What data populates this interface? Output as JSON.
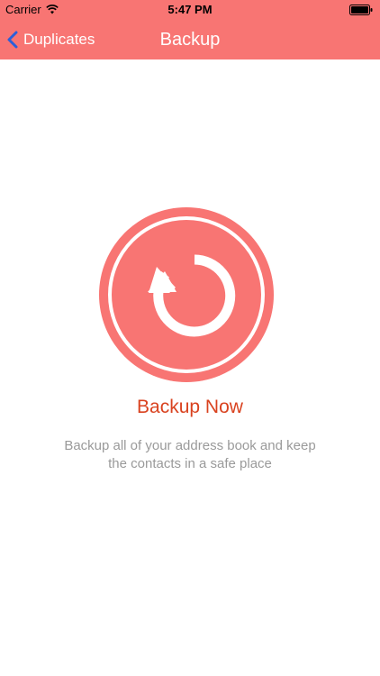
{
  "status_bar": {
    "carrier": "Carrier",
    "time": "5:47 PM",
    "wifi_icon": "wifi-icon",
    "battery_icon": "battery-icon"
  },
  "nav": {
    "back_label": "Duplicates",
    "back_icon": "chevron-left-icon",
    "title": "Backup"
  },
  "main": {
    "backup_icon": "circular-arrow-icon",
    "action_label": "Backup Now",
    "description": "Backup all of your address book and keep the contacts in a safe place"
  },
  "colors": {
    "accent": "#F87573",
    "action_text": "#D9421F",
    "back_chevron": "#2B5FD9",
    "description_text": "#9A9A9A"
  }
}
